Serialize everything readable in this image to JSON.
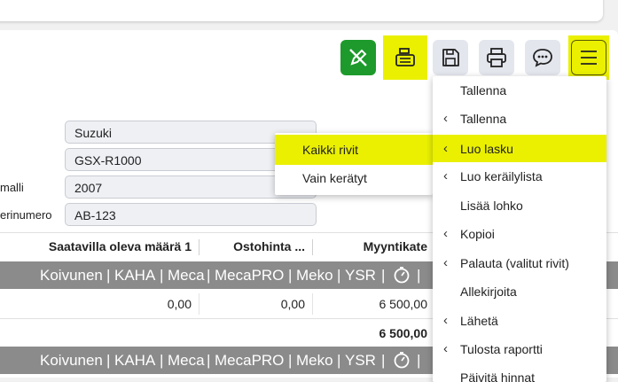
{
  "toolbar": {
    "buttons": [
      {
        "name": "no-edit-icon",
        "color": "#1d9a2b"
      },
      {
        "name": "cash-register-icon",
        "color": "#eaf000"
      },
      {
        "name": "save-icon"
      },
      {
        "name": "print-icon"
      },
      {
        "name": "chat-icon"
      },
      {
        "name": "hamburger-menu-icon",
        "color": "#eaf000"
      }
    ]
  },
  "form": {
    "fields": [
      {
        "label": "",
        "value": "Suzuki"
      },
      {
        "label": "",
        "value": "GSX-R1000"
      },
      {
        "label": "malli",
        "value": "2007"
      },
      {
        "label": "erinumero",
        "value": "AB-123"
      }
    ]
  },
  "table": {
    "headers": [
      "Saatavilla oleva määrä 1",
      "Ostohinta ...",
      "Myyntikate"
    ],
    "row": {
      "saatavilla": "0,00",
      "ostohinta": "0,00",
      "myyntikate": "6 500,00"
    },
    "total": "6 500,00"
  },
  "brand_bar": {
    "items": [
      "Koivunen",
      "KAHA",
      "Meca",
      "MecaPRO",
      "Meko",
      "YSR"
    ],
    "separator": "|"
  },
  "submenu": {
    "items": [
      "Kaikki rivit",
      "Vain kerätyt"
    ]
  },
  "menu": {
    "items": [
      {
        "label": "Tallenna",
        "chevron": false
      },
      {
        "label": "Tallenna",
        "chevron": true
      },
      {
        "label": "Luo lasku",
        "chevron": true,
        "active": true
      },
      {
        "label": "Luo keräilylista",
        "chevron": true
      },
      {
        "label": "Lisää lohko",
        "chevron": false
      },
      {
        "label": "Kopioi",
        "chevron": true
      },
      {
        "label": "Palauta (valitut rivit)",
        "chevron": true
      },
      {
        "label": "Allekirjoita",
        "chevron": false
      },
      {
        "label": "Lähetä",
        "chevron": true
      },
      {
        "label": "Tulosta raportti",
        "chevron": true
      },
      {
        "label": "Päivitä hinnat",
        "chevron": false
      }
    ]
  },
  "colors": {
    "accent": "#eaf000",
    "green": "#1d9a2b",
    "brand_bar": "#8b8b8b"
  }
}
